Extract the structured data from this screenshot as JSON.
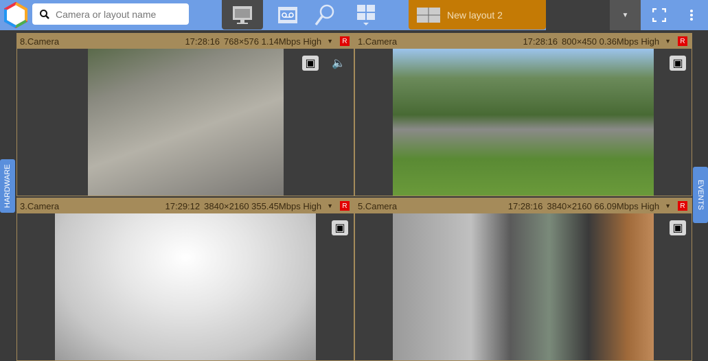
{
  "search": {
    "placeholder": "Camera or layout name"
  },
  "layout": {
    "name": "New layout 2"
  },
  "side": {
    "left": "HARDWARE",
    "right": "EVENTS"
  },
  "tiles": [
    {
      "name": "8.Camera",
      "time": "17:28:16",
      "info": "768×576 1.14Mbps High",
      "rec": "R"
    },
    {
      "name": "1.Camera",
      "time": "17:28:16",
      "info": "800×450 0.36Mbps High",
      "rec": "R"
    },
    {
      "name": "3.Camera",
      "time": "17:29:12",
      "info": "3840×2160 355.45Mbps High",
      "rec": "R"
    },
    {
      "name": "5.Camera",
      "time": "17:28:16",
      "info": "3840×2160 66.09Mbps High",
      "rec": "R"
    }
  ],
  "colors": {
    "topbar": "#6e9ee6",
    "layout_tab": "#c47a05",
    "tile_header": "#a58b5a",
    "rec": "#e20000"
  }
}
